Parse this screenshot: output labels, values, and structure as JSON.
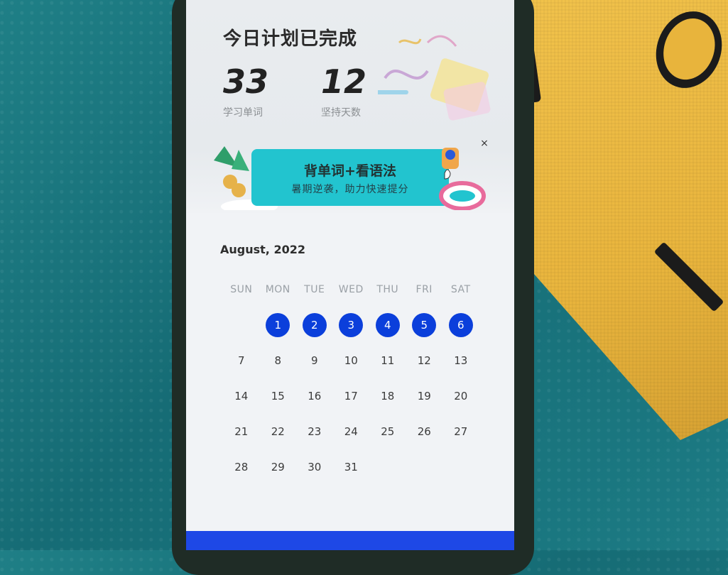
{
  "header": {
    "title": "今日计划已完成"
  },
  "stats": [
    {
      "value": "33",
      "label": "学习单词"
    },
    {
      "value": "12",
      "label": "坚持天数"
    }
  ],
  "banner": {
    "title": "背单词+看语法",
    "subtitle": "暑期逆袭，助力快速提分",
    "close_icon": "×"
  },
  "calendar": {
    "month": "August, 2022",
    "weekdays": [
      "SUN",
      "MON",
      "TUE",
      "WED",
      "THU",
      "FRI",
      "SAT"
    ],
    "weeks": [
      [
        "",
        "1",
        "2",
        "3",
        "4",
        "5",
        "6"
      ],
      [
        "7",
        "8",
        "9",
        "10",
        "11",
        "12",
        "13"
      ],
      [
        "14",
        "15",
        "16",
        "17",
        "18",
        "19",
        "20"
      ],
      [
        "21",
        "22",
        "23",
        "24",
        "25",
        "26",
        "27"
      ],
      [
        "28",
        "29",
        "30",
        "31",
        "",
        "",
        ""
      ]
    ],
    "completed_days": [
      "1",
      "2",
      "3",
      "4",
      "5",
      "6"
    ],
    "accent_color": "#0b3fdb"
  },
  "bottom_button": {
    "label": ""
  }
}
